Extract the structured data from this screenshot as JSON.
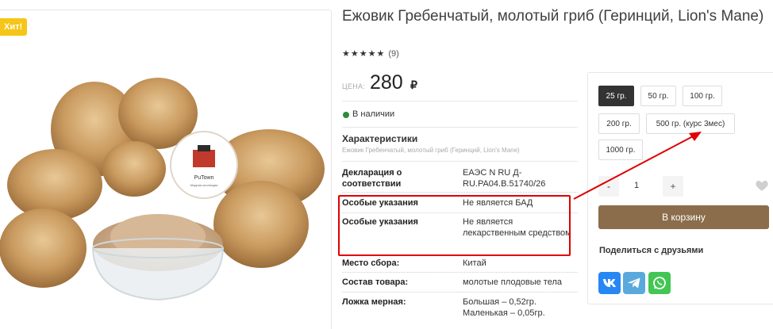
{
  "product": {
    "badge": "Хит!",
    "title": "Ежовик Гребенчатый, молотый гриб (Геринций, Lion's Mane)",
    "rating_stars": 5,
    "review_count": "(9)",
    "price_label": "ЦЕНА:",
    "price": "280",
    "currency": "₽",
    "stock": "В наличии",
    "logo_text": "PuTown",
    "logo_sub": "Модная коллекция"
  },
  "characteristics": {
    "title": "Характеристики",
    "subtitle": "Ежовик Гребенчатый, молотый гриб (Геринций, Lion's Mane)",
    "rows": [
      {
        "name": "Декларация о соответствии",
        "value": "ЕАЭС N RU Д-RU.PA04.B.51740/26"
      },
      {
        "name": "Особые указания",
        "value": "Не является БАД"
      },
      {
        "name": "Особые указания",
        "value": "Не является лекарственным средством"
      },
      {
        "name": "Место сбора:",
        "value": "Китай"
      },
      {
        "name": "Состав товара:",
        "value": "молотые плодовые тела"
      },
      {
        "name": "Ложка мерная:",
        "value": "Большая – 0,52гр. Маленькая – 0,05гр."
      }
    ]
  },
  "buy": {
    "weights": [
      "25 гр.",
      "50 гр.",
      "100 гр.",
      "200 гр.",
      "500 гр. (курс 3мес)",
      "1000 гр."
    ],
    "selected_weight": "25 гр.",
    "qty_minus": "-",
    "qty_value": "1",
    "qty_plus": "+",
    "cart_label": "В корзину",
    "share_title": "Поделиться с друзьями"
  },
  "colors": {
    "cart": "#8b6d4c",
    "badge": "#f5c518",
    "annotation": "#e00000",
    "in_stock": "#2e8b3a"
  }
}
